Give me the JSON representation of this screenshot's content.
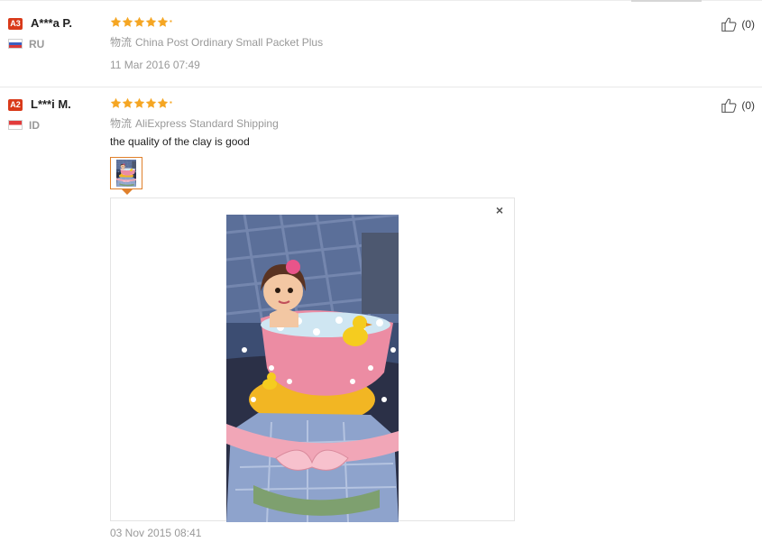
{
  "reviews": [
    {
      "badge": "A3",
      "name": "A***a P.",
      "country": "RU",
      "rating": 5,
      "shipping_label": "物流",
      "shipping_method": "China Post Ordinary Small Packet Plus",
      "feedback": "",
      "date": "11 Mar 2016 07:49",
      "helpful_count": "(0)"
    },
    {
      "badge": "A2",
      "name": "L***i M.",
      "country": "ID",
      "rating": 5,
      "shipping_label": "物流",
      "shipping_method": "AliExpress Standard Shipping",
      "feedback": "the quality of the clay is good",
      "date": "03 Nov 2015 08:41",
      "helpful_count": "(0)",
      "photo": {
        "close_symbol": "×",
        "description_icon": "cake-photo"
      }
    }
  ],
  "colors": {
    "badge": "#d93a1a",
    "star": "#f5a623",
    "accent_border": "#e0802b",
    "muted_text": "#999999"
  }
}
